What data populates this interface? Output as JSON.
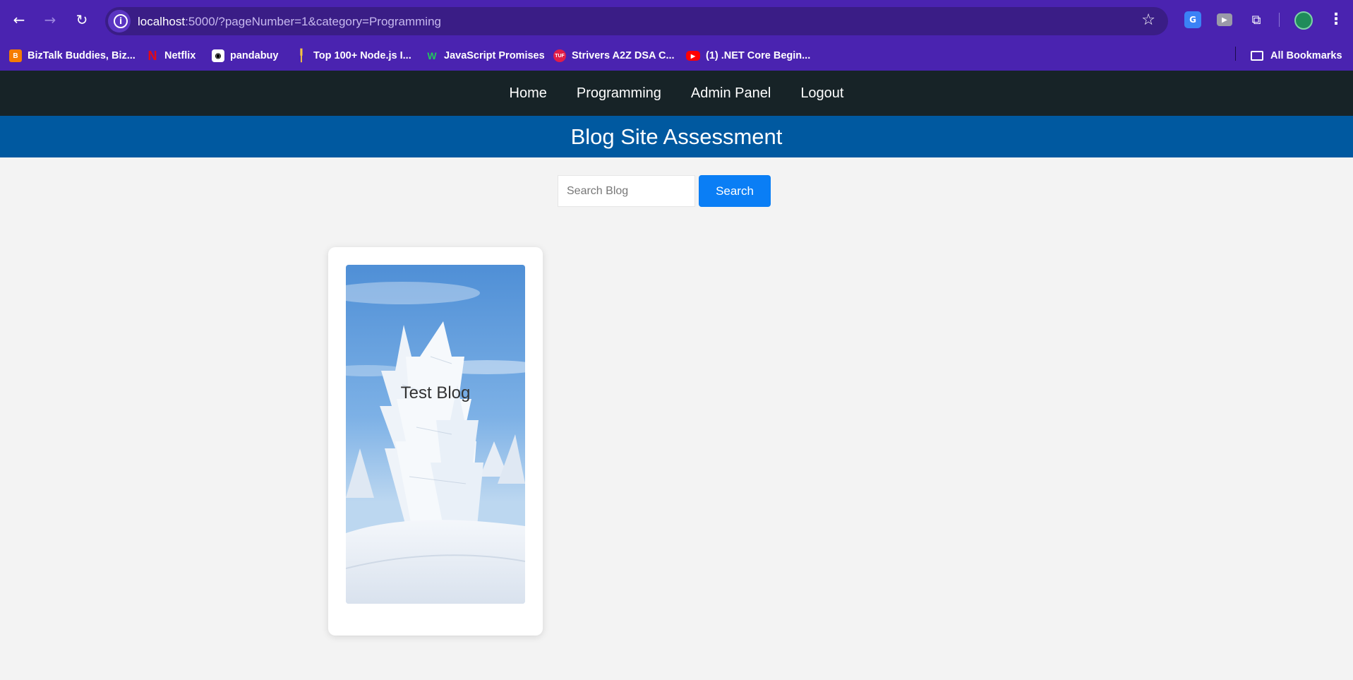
{
  "browser": {
    "url_host": "localhost",
    "url_rest": ":5000/?pageNumber=1&category=Programming",
    "bookmarks": [
      {
        "label": "BizTalk Buddies, Biz..."
      },
      {
        "label": "Netflix"
      },
      {
        "label": "pandabuy"
      },
      {
        "label": "Top 100+ Node.js I..."
      },
      {
        "label": "JavaScript Promises"
      },
      {
        "label": "Strivers A2Z DSA C..."
      },
      {
        "label": "(1) .NET Core Begin..."
      }
    ],
    "all_bookmarks": "All Bookmarks"
  },
  "nav": {
    "items": [
      {
        "label": "Home"
      },
      {
        "label": "Programming"
      },
      {
        "label": "Admin Panel"
      },
      {
        "label": "Logout"
      }
    ]
  },
  "header": {
    "title": "Blog Site Assessment"
  },
  "search": {
    "placeholder": "Search Blog",
    "button_label": "Search"
  },
  "posts": [
    {
      "title": "Test Blog"
    }
  ]
}
